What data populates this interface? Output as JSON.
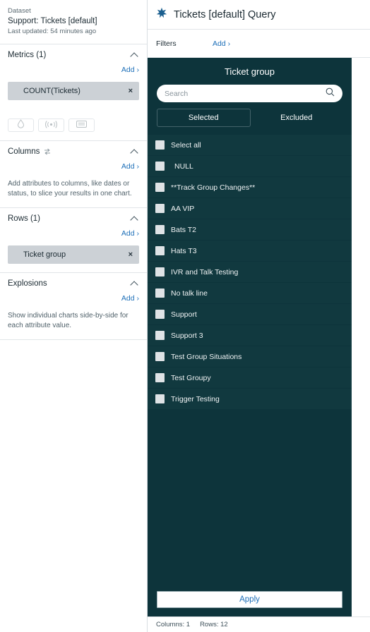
{
  "sidebar": {
    "dataset": {
      "label": "Dataset",
      "title": "Support: Tickets [default]",
      "updated": "Last updated: 54 minutes ago"
    },
    "metrics": {
      "title": "Metrics (1)",
      "add_label": "Add ›",
      "chips": [
        {
          "label": "COUNT(Tickets)",
          "remove": "×"
        }
      ],
      "icon_buttons": [
        {
          "name": "drop-icon"
        },
        {
          "name": "broadcast-icon"
        },
        {
          "name": "comment-icon"
        }
      ]
    },
    "columns": {
      "title": "Columns",
      "add_label": "Add ›",
      "hint": "Add attributes to columns, like dates or status, to slice your results in one chart."
    },
    "rows": {
      "title": "Rows (1)",
      "add_label": "Add ›",
      "chips": [
        {
          "label": "Ticket group",
          "remove": "×"
        }
      ]
    },
    "explosions": {
      "title": "Explosions",
      "add_label": "Add ›",
      "hint": "Show individual charts side-by-side for each attribute value."
    }
  },
  "query": {
    "title": "Tickets [default] Query",
    "filters_label": "Filters",
    "filters_add_label": "Add ›"
  },
  "picker": {
    "title": "Ticket group",
    "search_placeholder": "Search",
    "search_value": "",
    "tabs": [
      {
        "label": "Selected",
        "active": true
      },
      {
        "label": "Excluded",
        "active": false
      }
    ],
    "items": [
      {
        "label": "Select all",
        "checked": false,
        "indent": false
      },
      {
        "label": "NULL",
        "checked": false,
        "indent": true
      },
      {
        "label": "**Track Group Changes**",
        "checked": false,
        "indent": false
      },
      {
        "label": "AA VIP",
        "checked": false,
        "indent": false
      },
      {
        "label": "Bats T2",
        "checked": false,
        "indent": false
      },
      {
        "label": "Hats T3",
        "checked": false,
        "indent": false
      },
      {
        "label": "IVR and Talk Testing",
        "checked": false,
        "indent": false
      },
      {
        "label": "No talk line",
        "checked": false,
        "indent": false
      },
      {
        "label": "Support",
        "checked": false,
        "indent": false
      },
      {
        "label": "Support 3",
        "checked": false,
        "indent": false
      },
      {
        "label": "Test Group Situations",
        "checked": false,
        "indent": false
      },
      {
        "label": "Test Groupy",
        "checked": false,
        "indent": false
      },
      {
        "label": "Trigger Testing",
        "checked": false,
        "indent": false
      }
    ],
    "apply_label": "Apply"
  },
  "status": {
    "columns": "Columns: 1",
    "rows": "Rows: 12"
  },
  "colors": {
    "panel_dark": "#0d343b",
    "row_dark": "#11393f",
    "link_blue": "#1d6fb8",
    "chip_gray": "#ccd1d6",
    "star_blue": "#1b5f8f"
  }
}
